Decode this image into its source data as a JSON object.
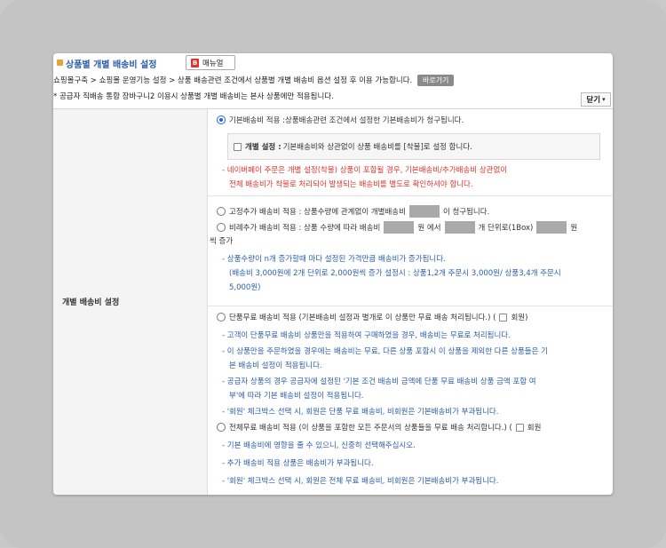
{
  "title": "상품별 개별 배송비 설정",
  "manual_label": "매뉴얼",
  "breadcrumb": "쇼핑몰구축 > 쇼핑몰 운영기능 설정 > 상품 배송관련 조건에서 상품별 개별 배송비 옵션 설정 후 이용 가능합니다.",
  "goto_label": "바로가기",
  "notice": "* 공급자 직배송 통합 장바구니2 이용시 상품별 개별 배송비는 본사 상품에만 적용됩니다.",
  "close_label": "닫기",
  "row_label": "개별 배송비 설정",
  "opt_basic": "기본배송비 적용 :상품배송관련 조건에서 설정한 기본배송비가 청구됩니다.",
  "sub_bold": "개별 설정 :",
  "sub_text": "기본배송비와 상관없이 상품 배송비를 [착불]로 설정 합니다.",
  "red1": "- 네이버페이 주문은 개별 설정(착불) 상품이 포함될 경우, 기본배송비/추가배송비 상관없이",
  "red2": "전체 배송비가 착불로 처리되어 발생되는 배송비를 별도로 확인하셔야 합니다.",
  "opt_fixed_a": "고정추가 배송비 적용 : 상품수량에 관계없이 개별배송비",
  "opt_fixed_b": "이 청구됩니다.",
  "opt_ratio_a": "비례추가 배송비 적용 : 상품 수량에 따라 배송비",
  "opt_ratio_b": "원 에서",
  "opt_ratio_c": "개 단위로(1Box)",
  "opt_ratio_d": "원",
  "opt_ratio_e": "씩 증가",
  "blue1": "- 상품수량이 n개 증가할때 마다 설정된 가격만큼 배송비가 증가됩니다.",
  "blue2": "(배송비 3,000원에 2개 단위로 2,000원씩 증가 설정시 : 상품1,2개 주문시 3,000원/ 상품3,4개 주문시",
  "blue3": "5,000원)",
  "opt_single": "단품무료 배송비 적용 (기본배송비 설정과 별개로 이 상품만 무료 배송 처리됩니다.)  (",
  "member_label": "회원)",
  "single1": "- 고객이 단품무료 배송비 상품만을 적용하여 구매하였을 경우, 배송비는 무료로 처리됩니다.",
  "single2": "- 이 상품만을 주문하였을 경우에는 배송비는 무료, 다른 상품 포함시 이 상품을 제외한 다른 상품들은 기",
  "single3": "본 배송비 설정이 적용됩니다.",
  "single4": "- 공급자 상품의 경우 공급자에 설정된 '기본 조건 배송비 금액에 단품 무료 배송비 상품 금액 포함 여",
  "single5": "부'에 따라 기본 배송비 설정이 적용됩니다.",
  "single6": "- '회원' 체크박스 선택 시, 회원은 단품 무료 배송비, 비회원은 기본배송비가 부과됩니다.",
  "opt_all": "전체무료 배송비 적용 (이 상품을 포함한 모든 주문서의 상품들을 무료 배송 처리합니다.)  (",
  "all_member_label": "회원",
  "all1": "- 기본 배송비에 영향을 줄 수 있으니, 신중히 선택해주십시오.",
  "all2": "- 추가 배송비 적용 상품은 배송비가 부과됩니다.",
  "all3": "- '회원' 체크박스 선택 시, 회원은 전체 무료 배송비, 비회원은 기본배송비가 부과됩니다."
}
